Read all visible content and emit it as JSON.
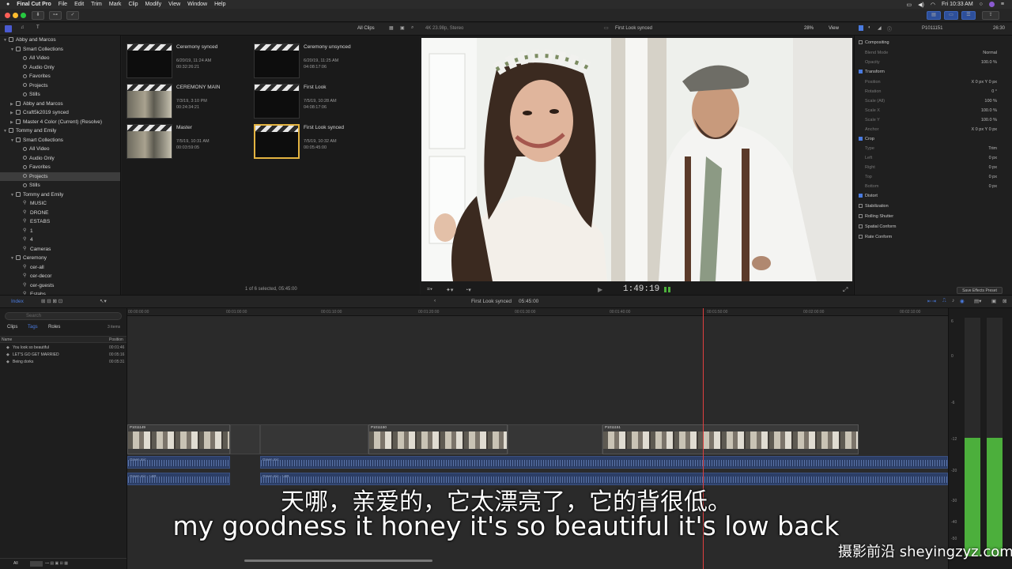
{
  "menu": {
    "app_name": "Final Cut Pro",
    "items": [
      "File",
      "Edit",
      "Trim",
      "Mark",
      "Clip",
      "Modify",
      "View",
      "Window",
      "Help"
    ],
    "clock": "Fri 10:33 AM"
  },
  "library": {
    "items": [
      {
        "label": "Abby and Marcos",
        "depth": 0,
        "kind": "library",
        "expanded": true
      },
      {
        "label": "Smart Collections",
        "depth": 1,
        "kind": "folder",
        "expanded": true
      },
      {
        "label": "All Video",
        "depth": 2,
        "kind": "smart"
      },
      {
        "label": "Audio Only",
        "depth": 2,
        "kind": "smart"
      },
      {
        "label": "Favorites",
        "depth": 2,
        "kind": "smart"
      },
      {
        "label": "Projects",
        "depth": 2,
        "kind": "smart"
      },
      {
        "label": "Stills",
        "depth": 2,
        "kind": "smart"
      },
      {
        "label": "Abby and Marcos",
        "depth": 1,
        "kind": "event"
      },
      {
        "label": "Craft5k2019 synced",
        "depth": 1,
        "kind": "event"
      },
      {
        "label": "Master 4 Color (Current) (Resolve)",
        "depth": 1,
        "kind": "event"
      },
      {
        "label": "Tommy and Emily",
        "depth": 0,
        "kind": "library",
        "expanded": true
      },
      {
        "label": "Smart Collections",
        "depth": 1,
        "kind": "folder",
        "expanded": true
      },
      {
        "label": "All Video",
        "depth": 2,
        "kind": "smart"
      },
      {
        "label": "Audio Only",
        "depth": 2,
        "kind": "smart"
      },
      {
        "label": "Favorites",
        "depth": 2,
        "kind": "smart"
      },
      {
        "label": "Projects",
        "depth": 2,
        "kind": "smart",
        "selected": true
      },
      {
        "label": "Stills",
        "depth": 2,
        "kind": "smart"
      },
      {
        "label": "Tommy and Emily",
        "depth": 1,
        "kind": "event",
        "expanded": true
      },
      {
        "label": "MUSIC",
        "depth": 2,
        "kind": "keyword"
      },
      {
        "label": "DRONE",
        "depth": 2,
        "kind": "keyword"
      },
      {
        "label": "ESTABS",
        "depth": 2,
        "kind": "keyword"
      },
      {
        "label": "1",
        "depth": 2,
        "kind": "keyword"
      },
      {
        "label": "4",
        "depth": 2,
        "kind": "keyword"
      },
      {
        "label": "Cameras",
        "depth": 2,
        "kind": "keyword"
      },
      {
        "label": "Ceremony",
        "depth": 1,
        "kind": "folder",
        "expanded": true
      },
      {
        "label": "cer-all",
        "depth": 2,
        "kind": "keyword"
      },
      {
        "label": "cer-decor",
        "depth": 2,
        "kind": "keyword"
      },
      {
        "label": "cer-guests",
        "depth": 2,
        "kind": "keyword"
      },
      {
        "label": "Estabs",
        "depth": 2,
        "kind": "keyword"
      }
    ]
  },
  "browser": {
    "filter": "All Clips",
    "status": "1 of 6 selected, 05:45:00",
    "clips": [
      {
        "title": "Ceremony  synced",
        "date": "6/20/19, 11:24 AM",
        "duration": "00:32:26:21",
        "thumb": "clapper"
      },
      {
        "title": "Ceremony unsynced",
        "date": "6/20/19, 11:25 AM",
        "duration": "04:08:17:06",
        "thumb": "clapper"
      },
      {
        "title": "CEREMONY MAIN",
        "date": "7/3/19, 3:10 PM",
        "duration": "00:24:34:21",
        "thumb": "photo"
      },
      {
        "title": "First Look",
        "date": "7/5/19, 10:28 AM",
        "duration": "04:08:17:06",
        "thumb": "clapper"
      },
      {
        "title": "Master",
        "date": "7/5/19, 10:31 AM",
        "duration": "00:03:59:05",
        "thumb": "photo"
      },
      {
        "title": "First Look synced",
        "date": "7/5/19, 10:32 AM",
        "duration": "00:05:45:00",
        "thumb": "clapper",
        "selected": true
      }
    ]
  },
  "viewer": {
    "format": "4K 23.98p, Stereo",
    "title": "First Look synced",
    "zoom": "28%",
    "view_label": "View",
    "timecode": "1:49:19"
  },
  "inspector": {
    "clip_name": "P1011151",
    "duration": "26:30",
    "rows": [
      {
        "label": "Compositing",
        "value": "",
        "section": true
      },
      {
        "label": "Blend Mode",
        "value": "Normal"
      },
      {
        "label": "Opacity",
        "value": "100.0 %"
      },
      {
        "label": "Transform",
        "value": "",
        "section": true,
        "checked": true
      },
      {
        "label": "Position",
        "value": "X   0 px   Y   0 px"
      },
      {
        "label": "Rotation",
        "value": "0 °"
      },
      {
        "label": "Scale (All)",
        "value": "100 %"
      },
      {
        "label": "Scale X",
        "value": "100.0 %"
      },
      {
        "label": "Scale Y",
        "value": "100.0 %"
      },
      {
        "label": "Anchor",
        "value": "X   0 px   Y   0 px"
      },
      {
        "label": "Crop",
        "value": "",
        "section": true,
        "checked": true
      },
      {
        "label": "Type",
        "value": "Trim"
      },
      {
        "label": "Left",
        "value": "0 px"
      },
      {
        "label": "Right",
        "value": "0 px"
      },
      {
        "label": "Top",
        "value": "0 px"
      },
      {
        "label": "Bottom",
        "value": "0 px"
      },
      {
        "label": "Distort",
        "value": "",
        "section": true,
        "checked": true
      },
      {
        "label": "Stabilization",
        "value": "",
        "section": true
      },
      {
        "label": "Rolling Shutter",
        "value": "",
        "section": true
      },
      {
        "label": "Spatial Conform",
        "value": "",
        "section": true
      },
      {
        "label": "Rate Conform",
        "value": "",
        "section": true
      }
    ],
    "save_preset": "Save Effects Preset"
  },
  "midbar": {
    "index_label": "Index",
    "project": "First Look synced",
    "duration": "05:45:00"
  },
  "timeline_index": {
    "tabs": [
      "Clips",
      "Tags",
      "Roles"
    ],
    "active_tab": "Tags",
    "count": "3 items",
    "search_placeholder": "Search",
    "col_name": "Name",
    "col_position": "Position",
    "rows": [
      {
        "name": "You look so beautiful",
        "position": "00:01:46"
      },
      {
        "name": "LET'S GO GET MARRIED",
        "position": "00:05:16"
      },
      {
        "name": "Being dorks",
        "position": "00:05:31"
      }
    ],
    "footer_tab": "All"
  },
  "timeline": {
    "ruler": [
      "00:00:00:00",
      "00:01:00:00",
      "00:01:10:00",
      "00:01:20:00",
      "00:01:30:00",
      "00:01:40:00",
      "00:01:50:00",
      "00:02:00:00",
      "00:02:10:00"
    ],
    "clips": [
      {
        "label": "P1011149"
      },
      {
        "label": "P1011150"
      },
      {
        "label": "P1011151"
      }
    ],
    "audio_top": [
      "Green mic",
      "Green mic"
    ],
    "audio_bottom": [
      "Green mic - L&R",
      "Green mic - L&R"
    ]
  },
  "meters": {
    "scale": [
      "6",
      "0",
      "-6",
      "-12",
      "-20",
      "-30",
      "-40",
      "-50"
    ]
  },
  "subtitles": {
    "chinese": "天哪，亲爱的，它太漂亮了，它的背很低。",
    "english": "my goodness it honey it's so beautiful it's low back"
  },
  "watermark": "摄影前沿 sheyingzyz.com",
  "colors": {
    "accent": "#4a7be0",
    "playhead": "#e04040",
    "meter": "#4caf3c",
    "selection": "#e3b341"
  }
}
